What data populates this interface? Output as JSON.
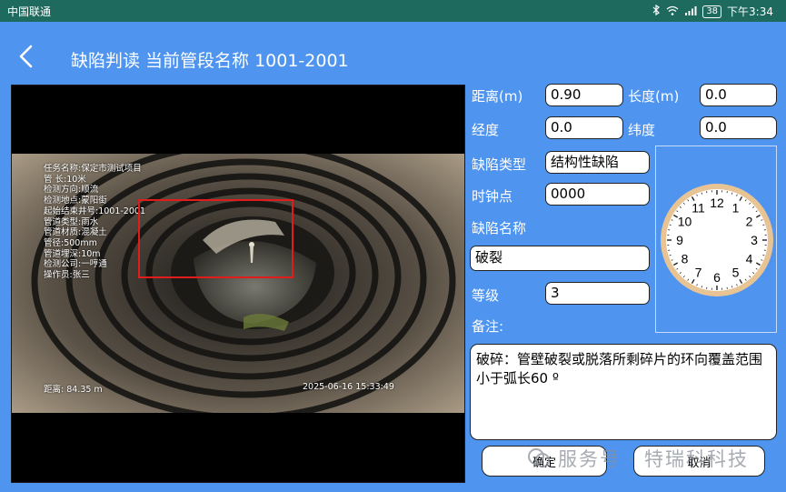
{
  "statusbar": {
    "carrier": "中国联通",
    "battery": "38",
    "time": "下午3:34"
  },
  "header": {
    "title": "缺陷判读 当前管段名称 1001-2001"
  },
  "video": {
    "overlay_lines": [
      "任务名称:保定市测试项目",
      "管 长:10米",
      "检测方向:顺流",
      "检测地点:蒙阳街",
      "起始结束井号:1001-2001",
      "管道类型:雨水",
      "管道材质:混凝土",
      "管径:500mm",
      "管道埋深:10m",
      "检测公司:一哼通",
      "操作员:张三"
    ],
    "distance": "距离: 84.35 m",
    "timestamp": "2025-06-16 15:33:49"
  },
  "form": {
    "distance_label": "距离(m)",
    "distance_value": "0.90",
    "length_label": "长度(m)",
    "length_value": "0.0",
    "longitude_label": "经度",
    "longitude_value": "0.0",
    "latitude_label": "纬度",
    "latitude_value": "0.0",
    "defect_type_label": "缺陷类型",
    "defect_type_value": "结构性缺陷",
    "clock_label": "时钟点",
    "clock_value": "0000",
    "defect_name_label": "缺陷名称",
    "defect_name_value": "破裂",
    "grade_label": "等级",
    "grade_value": "3",
    "remark_label": "备注:",
    "remark_value": "破碎：管壁破裂或脱落所剩碎片的环向覆盖范围小于弧长60 º"
  },
  "clock_numbers": [
    "12",
    "1",
    "2",
    "3",
    "4",
    "5",
    "6",
    "7",
    "8",
    "9",
    "10",
    "11"
  ],
  "buttons": {
    "confirm": "确定",
    "cancel": "取消"
  },
  "watermark": "服务号 · 特瑞科科技",
  "colors": {
    "background": "#4f95f0",
    "statusbar": "#1e6a5e",
    "defect_box": "#e21b1b",
    "clock_rim": "#e8c495"
  },
  "icons": {
    "back": "chevron-left-icon",
    "wifi": "wifi-icon",
    "bluetooth": "bluetooth-icon",
    "signal": "signal-icon"
  }
}
